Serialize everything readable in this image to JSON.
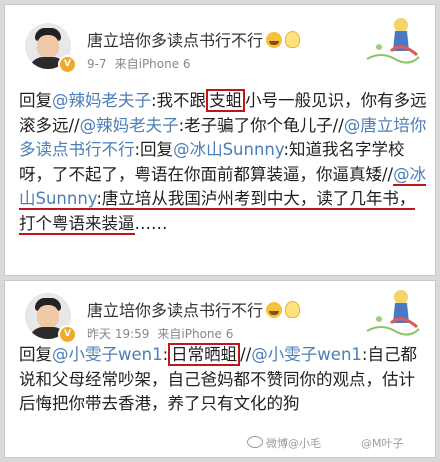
{
  "posts": [
    {
      "name": "唐立培你多读点书行不行",
      "time": "9-7",
      "source": "来自iPhone 6",
      "segments": [
        {
          "t": "回复"
        },
        {
          "t": "@辣妈老夫子",
          "cls": "link"
        },
        {
          "t": ":我不跟"
        },
        {
          "t": "支蛆",
          "cls": "box"
        },
        {
          "t": "小号一般见识，你有多远滚多远//"
        },
        {
          "t": "@辣妈老夫子",
          "cls": "link"
        },
        {
          "t": ":老子骗了你个龟儿子//"
        },
        {
          "t": "@唐立培你多读点书行不行",
          "cls": "link"
        },
        {
          "t": ":回复"
        },
        {
          "t": "@冰山Sunnny",
          "cls": "link"
        },
        {
          "t": ":知道我名字学校呀，了不起了，粤语在你面前都算装逼，你逼真矮//"
        },
        {
          "t": "@冰山Sunnny",
          "cls": "link ul"
        },
        {
          "t": ":唐立培从我国泸州考到中大，读了几年书，打个粤语来装逼",
          "cls": "ul"
        },
        {
          "t": "……"
        }
      ]
    },
    {
      "name": "唐立培你多读点书行不行",
      "time": "昨天 19:59",
      "source": "来自iPhone 6",
      "segments": [
        {
          "t": "回复"
        },
        {
          "t": "@小雯子wen1",
          "cls": "link"
        },
        {
          "t": ":"
        },
        {
          "t": "日常晒蛆",
          "cls": "box"
        },
        {
          "t": "//"
        },
        {
          "t": "@小雯子wen1",
          "cls": "link"
        },
        {
          "t": ":自己都说和父母经常吵架，自己爸妈都不赞同你的观点，估计后悔把你带去香港，养了只有文化的狗"
        }
      ]
    }
  ],
  "watermarks": [
    "微博@小毛",
    "@M叶子"
  ],
  "icons": {
    "avatar": "avatar-photo",
    "verified": "verified-badge-icon",
    "emoji1": "crying-face-icon",
    "emoji2": "lightbulb-icon",
    "decoration": "card-decoration-illustration"
  },
  "colors": {
    "link": "#4b7db8",
    "highlight": "#c0161b",
    "verified": "#f3a826"
  }
}
